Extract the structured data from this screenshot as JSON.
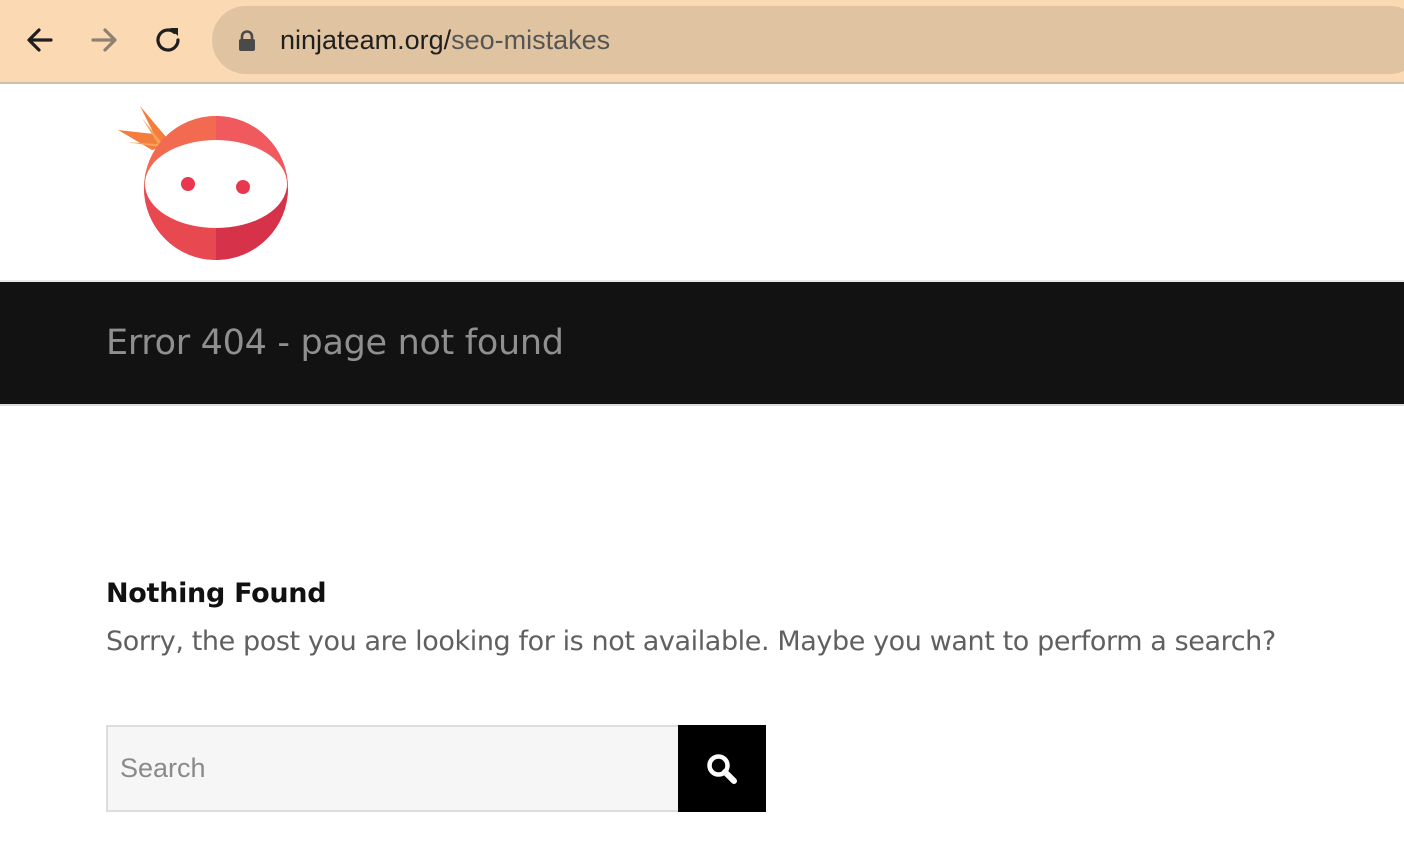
{
  "browser": {
    "url_host": "ninjateam.org/",
    "url_path": "seo-mistakes",
    "icons": {
      "back": "back-arrow-icon",
      "forward": "forward-arrow-icon",
      "reload": "reload-icon",
      "lock": "lock-icon"
    }
  },
  "site": {
    "logo": "ninja-face-logo",
    "brand_color": "#e8384f",
    "accent_orange": "#f47c3c"
  },
  "page": {
    "title": "Error 404 - page not found"
  },
  "content": {
    "heading": "Nothing Found",
    "message": "Sorry, the post you are looking for is not available. Maybe you want to perform a search?"
  },
  "search": {
    "placeholder": "Search",
    "value": "",
    "button_icon": "search-icon"
  }
}
